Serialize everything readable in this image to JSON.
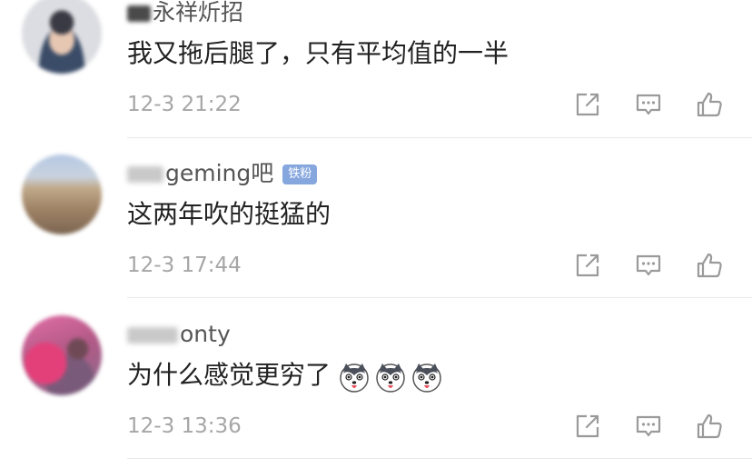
{
  "comments": [
    {
      "username": "永祥炘招",
      "badge": "",
      "text": "我又拖后腿了，只有平均值的一半",
      "time": "12-3 21:22",
      "emojis": []
    },
    {
      "username": "geming吧",
      "badge": "铁粉",
      "text": "这两年吹的挺猛的",
      "time": "12-3 17:44",
      "emojis": []
    },
    {
      "username": "onty",
      "badge": "",
      "text": "为什么感觉更穷了",
      "time": "12-3 13:36",
      "emojis": [
        "husky-emoji",
        "husky-emoji",
        "husky-emoji"
      ]
    }
  ],
  "icons": {
    "share": "share-icon",
    "reply": "comment-icon",
    "like": "thumbs-up-icon"
  },
  "colors": {
    "username": "#555555",
    "text": "#222222",
    "time": "#a6a6a6",
    "badge": "#86a6de",
    "icon": "#9a9a9a",
    "divider": "#e9e9e9"
  }
}
